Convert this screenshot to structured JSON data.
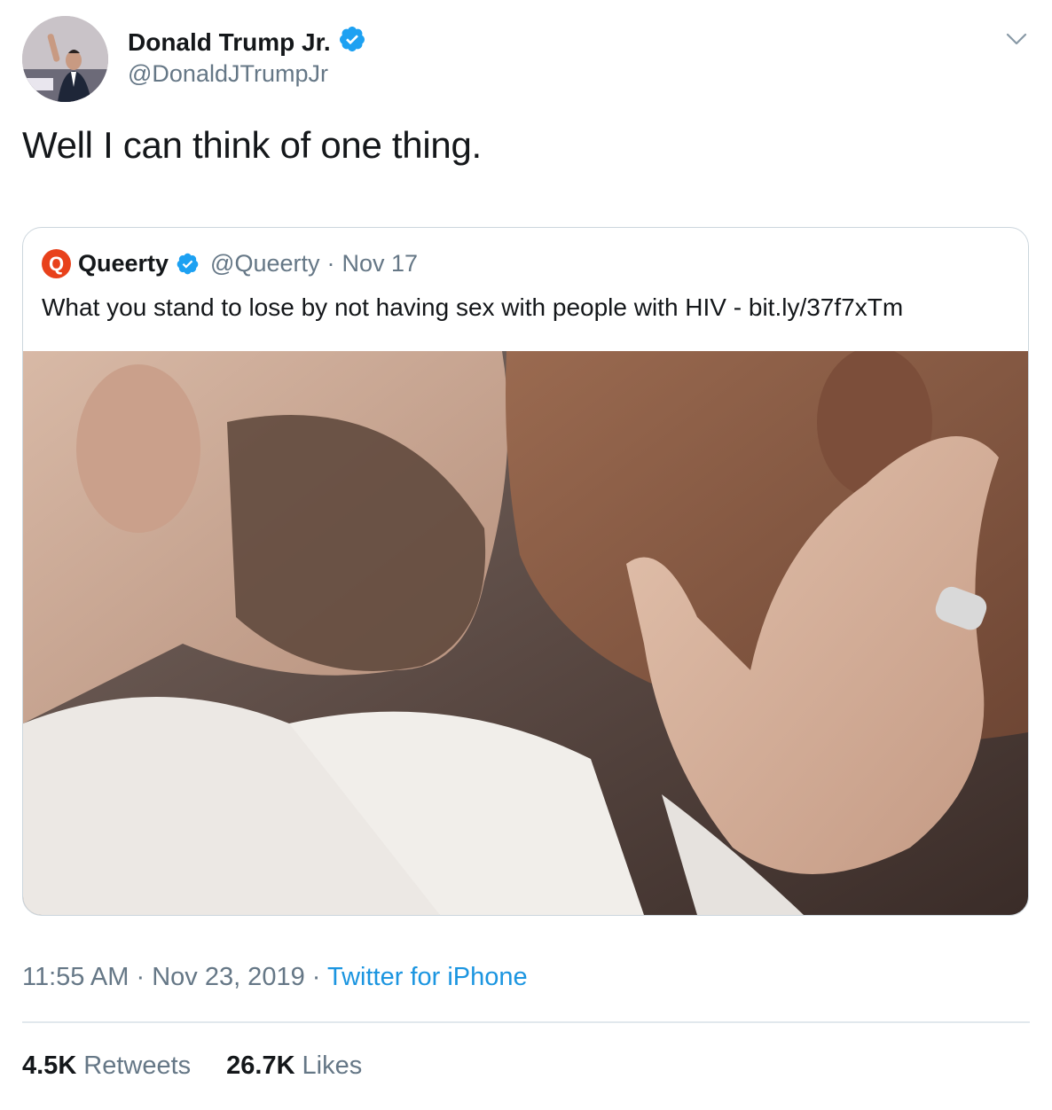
{
  "author": {
    "name": "Donald Trump Jr.",
    "handle": "@DonaldJTrumpJr"
  },
  "tweet": {
    "text": "Well I can think of one thing."
  },
  "quoted_tweet": {
    "logo_letter": "Q",
    "name": "Queerty",
    "handle": "@Queerty",
    "separator": "·",
    "date": "Nov 17",
    "text": "What you stand to lose by not having sex with people with HIV - bit.ly/37f7xTm"
  },
  "meta": {
    "time": "11:55 AM",
    "sep1": "·",
    "date": "Nov 23, 2019",
    "sep2": "·",
    "source": "Twitter for iPhone"
  },
  "stats": {
    "retweets_count": "4.5K",
    "retweets_label": "Retweets",
    "likes_count": "26.7K",
    "likes_label": "Likes"
  },
  "colors": {
    "verified": "#1da1f2",
    "link": "#1b95e0",
    "secondary_text": "#657786",
    "queerty_brand": "#e8411b"
  },
  "icons": {
    "verified": "verified-badge-icon",
    "caret": "chevron-down-icon"
  }
}
